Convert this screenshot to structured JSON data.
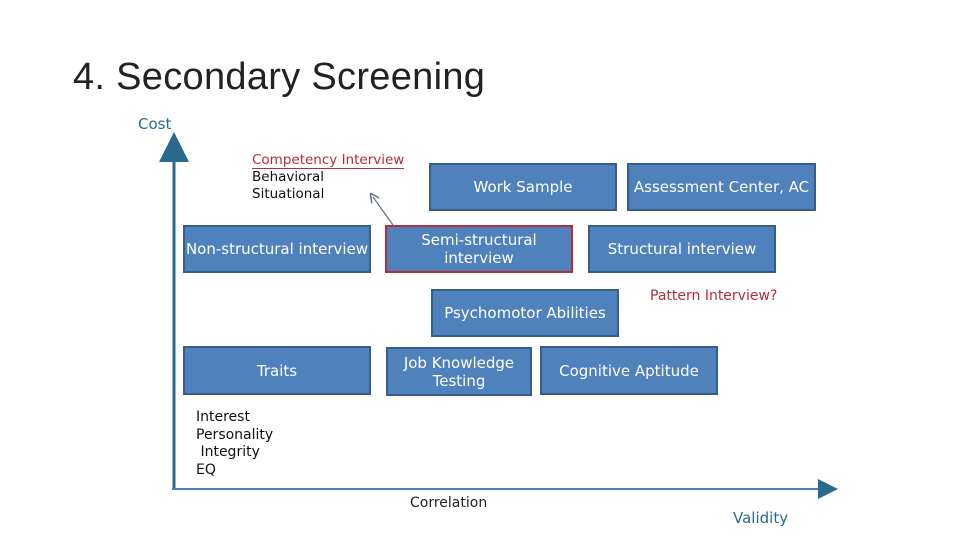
{
  "title": "4. Secondary Screening",
  "axes": {
    "y_label": "Cost",
    "x_label": "Validity",
    "x_sublabel": "Correlation",
    "color": "#2b6a8e"
  },
  "boxes": {
    "work_sample": "Work Sample",
    "assessment_center": "Assessment Center, AC",
    "non_structural": "Non-structural interview",
    "semi_structural": "Semi-structural interview",
    "structural": "Structural interview",
    "psychomotor": "Psychomotor Abilities",
    "traits": "Traits",
    "job_knowledge_line1": "Job Knowledge",
    "job_knowledge_line2": "Testing",
    "cognitive": "Cognitive Aptitude"
  },
  "competency_note": {
    "heading": "Competency Interview",
    "items": [
      "Behavioral",
      "Situational"
    ]
  },
  "pattern_note": "Pattern Interview?",
  "traits_note": {
    "items": [
      "Interest",
      "Personality",
      " Integrity",
      "EQ"
    ]
  },
  "colors": {
    "box_fill": "#4f81bd",
    "box_border": "#385d8a",
    "highlight": "#b42d3a"
  }
}
